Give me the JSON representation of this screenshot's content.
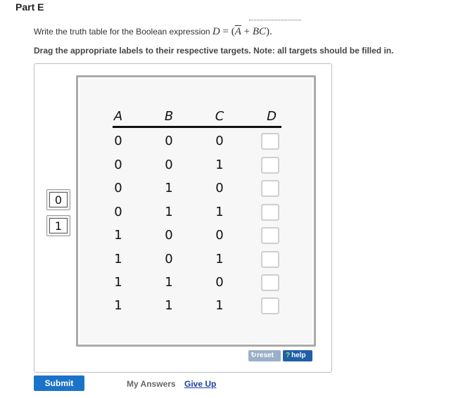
{
  "part_title": "Part E",
  "question": {
    "prefix": "Write the truth table for the Boolean expression ",
    "lhs": "D",
    "equals": " = (",
    "a_bar": "A",
    "plus": " + ",
    "bc": "BC",
    "close": ")."
  },
  "instruction": "Drag the appropriate labels to their respective targets. Note: all targets should be filled in.",
  "table": {
    "headers": [
      "A",
      "B",
      "C",
      "D"
    ],
    "rows": [
      [
        "0",
        "0",
        "0"
      ],
      [
        "0",
        "0",
        "1"
      ],
      [
        "0",
        "1",
        "0"
      ],
      [
        "0",
        "1",
        "1"
      ],
      [
        "1",
        "0",
        "0"
      ],
      [
        "1",
        "0",
        "1"
      ],
      [
        "1",
        "1",
        "0"
      ],
      [
        "1",
        "1",
        "1"
      ]
    ]
  },
  "labels": [
    "0",
    "1"
  ],
  "buttons": {
    "reset": "reset",
    "help": "help",
    "submit": "Submit",
    "my_answers": "My Answers",
    "give_up": "Give Up"
  }
}
